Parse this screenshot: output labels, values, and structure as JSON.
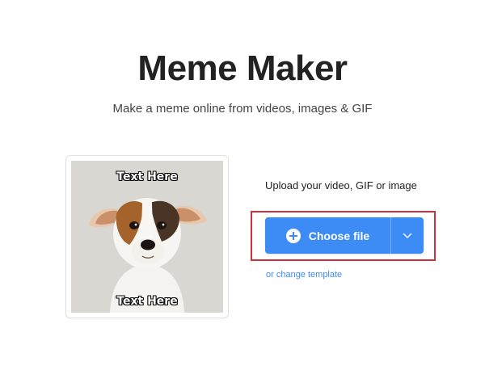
{
  "header": {
    "title": "Meme Maker",
    "subtitle": "Make a meme online from videos, images & GIF"
  },
  "preview": {
    "top_text": "Text Here",
    "bottom_text": "Text Here",
    "image_subject": "dog"
  },
  "upload": {
    "label": "Upload your video, GIF or image",
    "choose_button_label": "Choose file",
    "plus_icon": "plus-circle-icon",
    "dropdown_icon": "chevron-down-icon",
    "change_template_link": "or change template"
  },
  "colors": {
    "accent": "#3d8cf5",
    "highlight_border": "#d32f3a",
    "title_text": "#222222"
  }
}
